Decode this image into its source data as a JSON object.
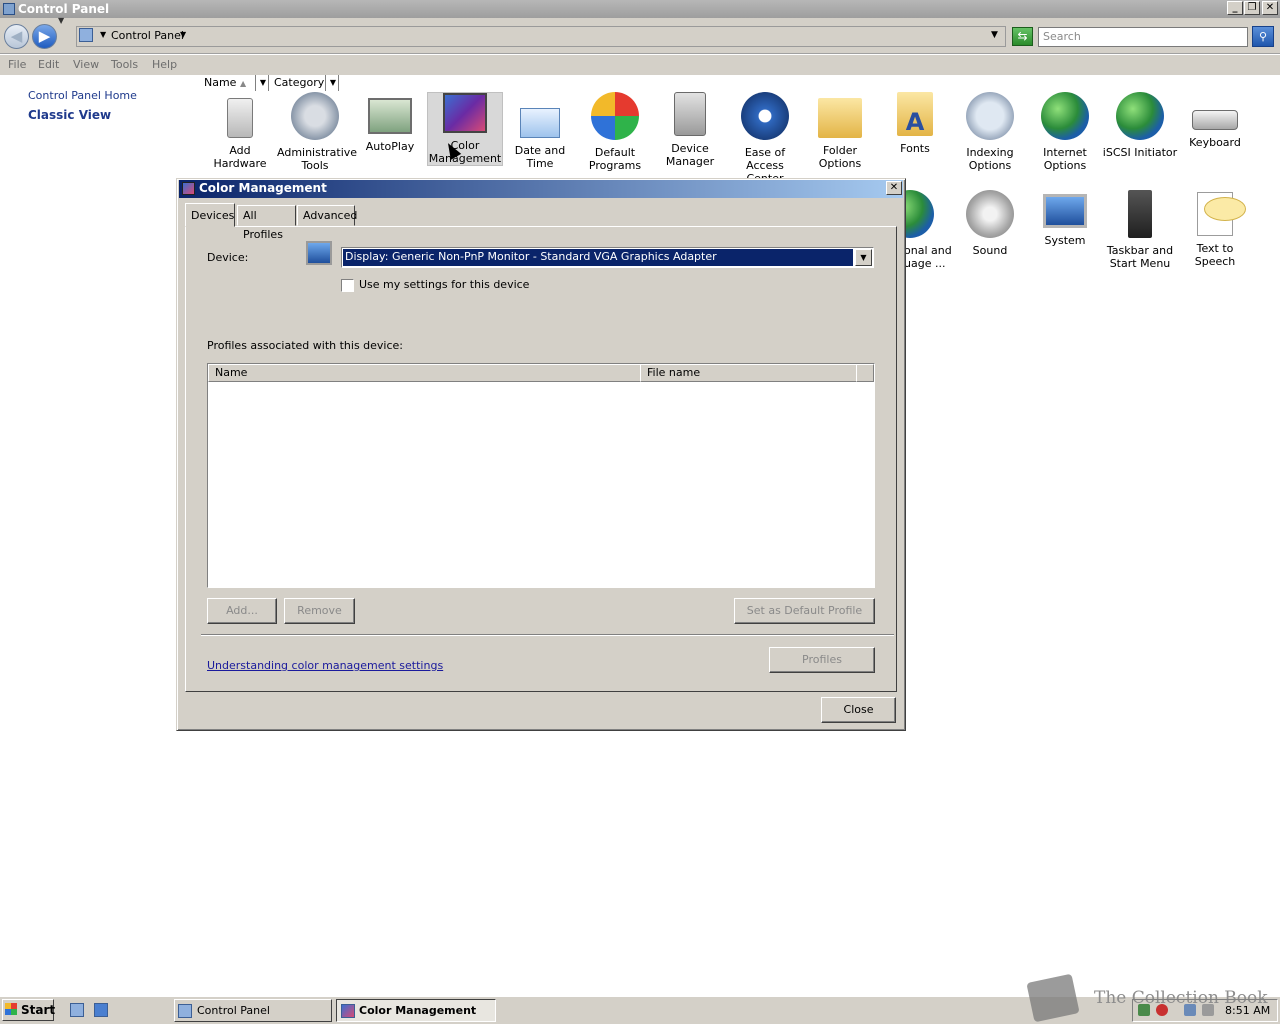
{
  "window": {
    "title": "Control Panel",
    "minimize": "_",
    "restore": "❐",
    "close": "✕"
  },
  "address": {
    "back": "◀",
    "forward": "▶",
    "path": "Control Panel",
    "search_placeholder": "Search"
  },
  "menu": [
    "File",
    "Edit",
    "View",
    "Tools",
    "Help"
  ],
  "sidebar": {
    "home": "Control Panel Home",
    "classic": "Classic View"
  },
  "columns": {
    "name": "Name",
    "category": "Category"
  },
  "items_row1": [
    {
      "label": "Add Hardware",
      "icon": "add-hardware-icon"
    },
    {
      "label": "Administrative Tools",
      "icon": "administrative-tools-icon"
    },
    {
      "label": "AutoPlay",
      "icon": "autoplay-icon"
    },
    {
      "label": "Color Management",
      "icon": "color-management-icon"
    },
    {
      "label": "Date and Time",
      "icon": "date-time-icon"
    },
    {
      "label": "Default Programs",
      "icon": "default-programs-icon"
    },
    {
      "label": "Device Manager",
      "icon": "device-manager-icon"
    },
    {
      "label": "Ease of Access Center",
      "icon": "ease-of-access-icon"
    },
    {
      "label": "Folder Options",
      "icon": "folder-options-icon"
    },
    {
      "label": "Fonts",
      "icon": "fonts-icon"
    },
    {
      "label": "Indexing Options",
      "icon": "indexing-options-icon"
    },
    {
      "label": "Internet Options",
      "icon": "internet-options-icon"
    },
    {
      "label": "iSCSI Initiator",
      "icon": "iscsi-initiator-icon"
    },
    {
      "label": "Keyboard",
      "icon": "keyboard-icon"
    }
  ],
  "items_row2": [
    {
      "label": "onal and uage ...",
      "icon": "regional-language-icon"
    },
    {
      "label": "Sound",
      "icon": "sound-icon"
    },
    {
      "label": "System",
      "icon": "system-icon"
    },
    {
      "label": "Taskbar and Start Menu",
      "icon": "taskbar-start-menu-icon"
    },
    {
      "label": "Text to Speech",
      "icon": "text-to-speech-icon"
    }
  ],
  "dialog": {
    "title": "Color Management",
    "close": "✕",
    "tabs": [
      "Devices",
      "All Profiles",
      "Advanced"
    ],
    "device_label": "Device:",
    "device_value": "Display: Generic Non-PnP Monitor - Standard VGA Graphics Adapter",
    "use_settings": "Use my settings for this device",
    "profiles_label": "Profiles associated with this device:",
    "list_headers": [
      "Name",
      "File name"
    ],
    "btn_add": "Add...",
    "btn_remove": "Remove",
    "btn_default": "Set as Default Profile",
    "btn_profiles": "Profiles",
    "link": "Understanding color management settings",
    "btn_close": "Close"
  },
  "taskbar": {
    "start": "Start",
    "tasks": [
      "Control Panel",
      "Color Management"
    ],
    "clock": "8:51 AM",
    "watermark": "The Collection Book"
  }
}
